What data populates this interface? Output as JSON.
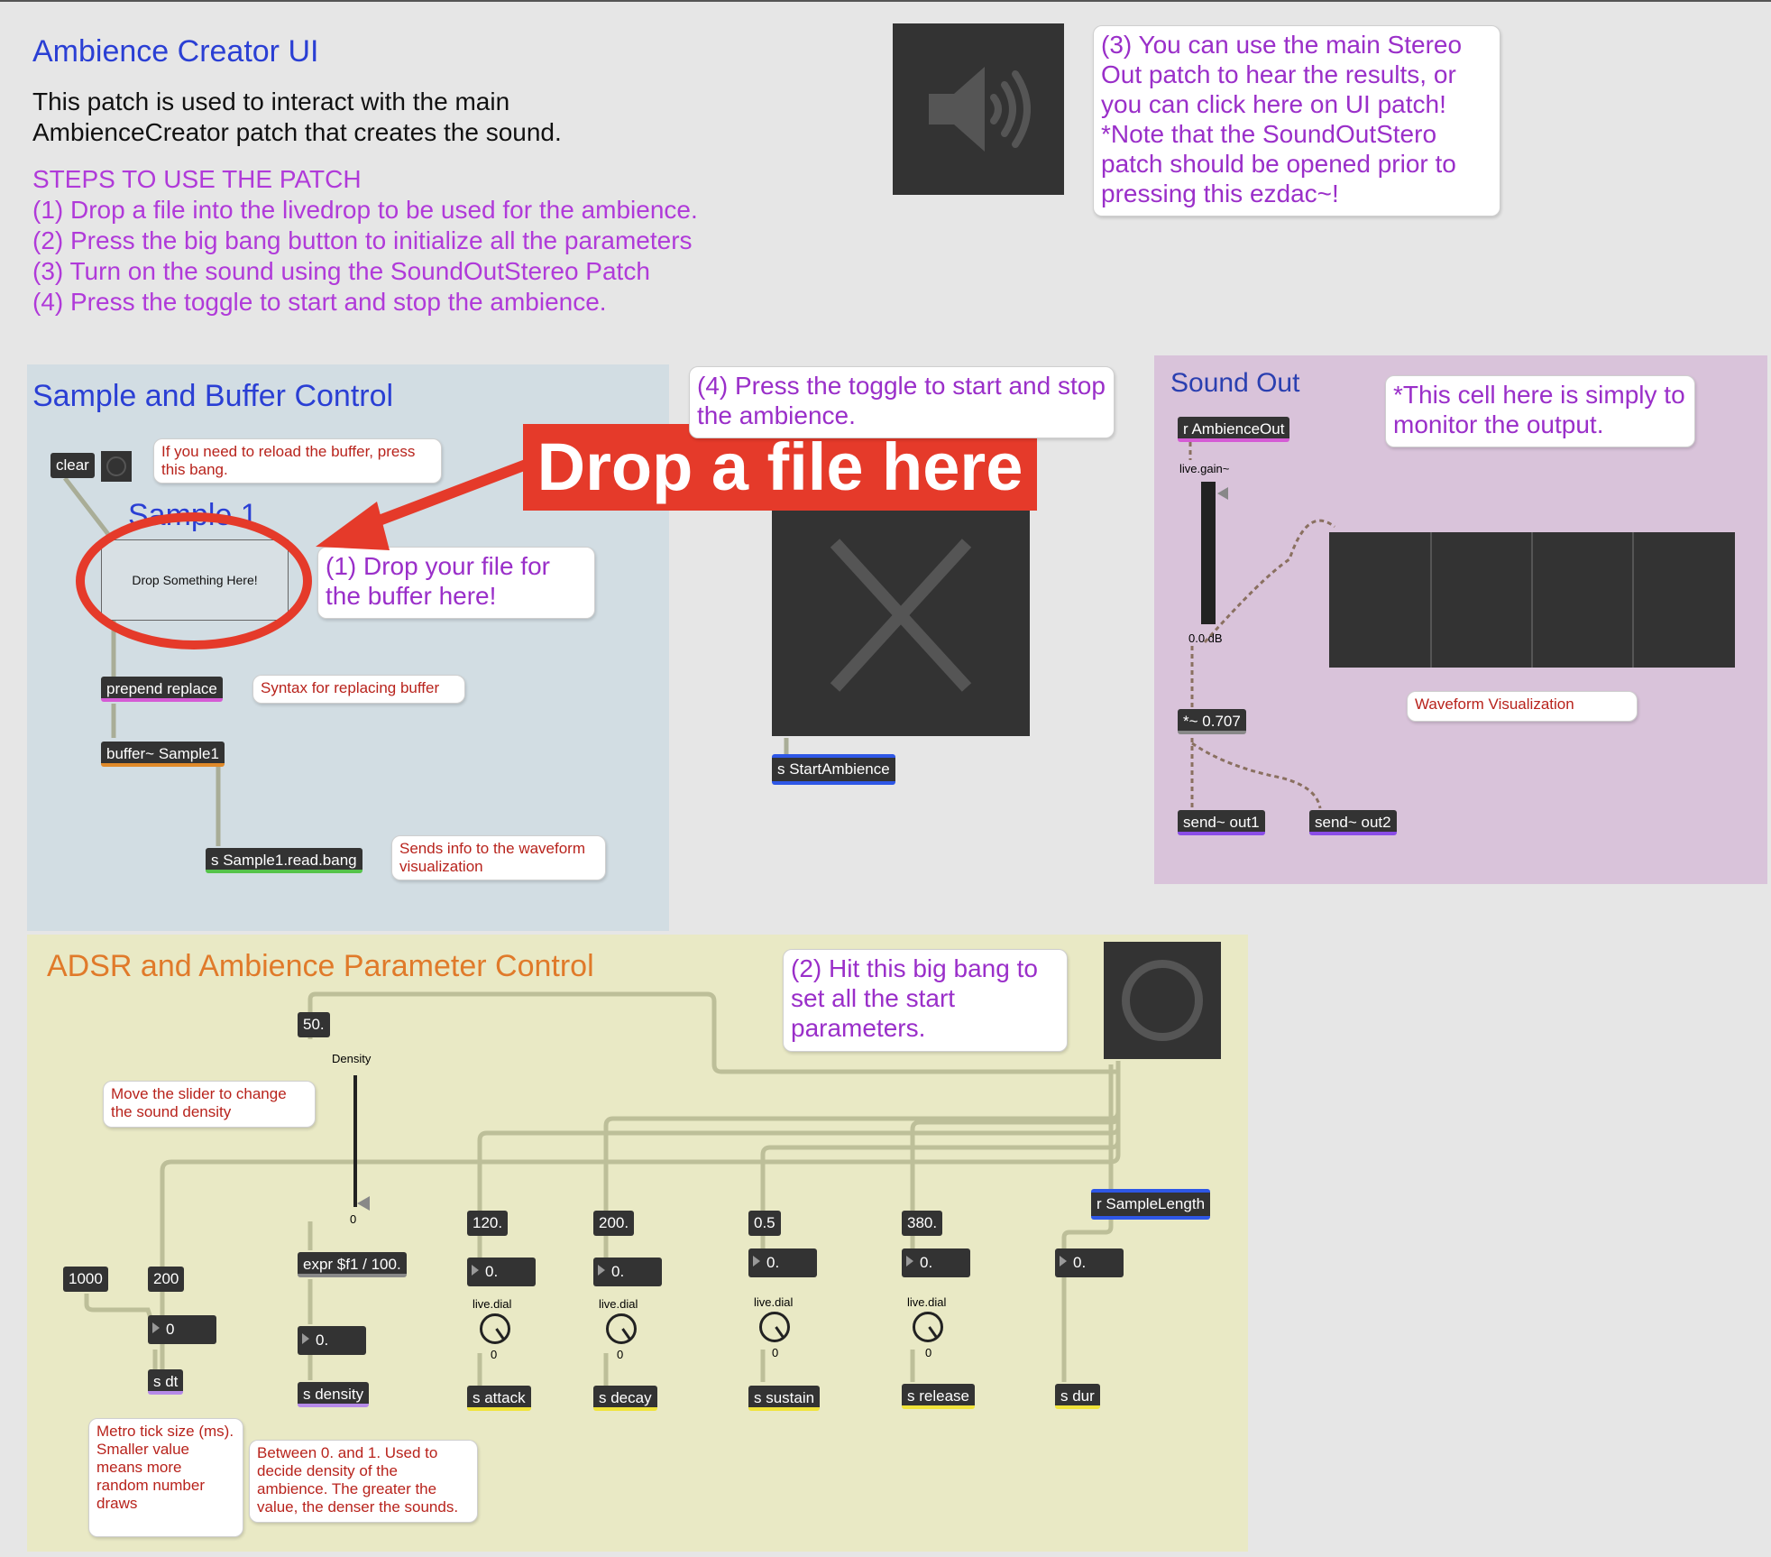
{
  "header": {
    "title": "Ambience Creator UI",
    "description_lines": [
      "This patch is used to interact with the main",
      "AmbienceCreator patch that creates the sound."
    ],
    "steps_title": "STEPS TO USE THE PATCH",
    "steps": [
      "(1) Drop a file into the livedrop to be used for the ambience.",
      "(2) Press the big bang button to initialize all the parameters",
      "(3) Turn on the sound using the SoundOutStereo Patch",
      "(4) Press the toggle to start and stop the ambience."
    ],
    "ezdac_comment": "(3) You can use the main Stereo Out patch to hear the results, or you can click here on UI patch! *Note that the SoundOutStero patch should be opened prior to pressing this ezdac~!",
    "ezdac_icon": "speaker-icon"
  },
  "sample_panel": {
    "title": "Sample and Buffer Control",
    "clear_label": "clear",
    "reload_comment": "If you need to reload the buffer, press this bang.",
    "sample_name": "Sample 1",
    "drop_text": "Drop Something Here!",
    "drop_comment": "(1) Drop your file for the buffer here!",
    "prepend_label": "prepend replace",
    "prepend_comment": "Syntax for replacing buffer",
    "buffer_label": "buffer~ Sample1",
    "send_label": "s Sample1.read.bang",
    "send_comment": "Sends info to the waveform visualization",
    "annotation_banner": "Drop a file here"
  },
  "toggle_panel": {
    "comment": "(4) Press the toggle to start and stop the ambience.",
    "send_label": "s StartAmbience",
    "toggle_icon": "close-x-icon"
  },
  "sound_out": {
    "title": "Sound Out",
    "comment": "*This cell here is simply to monitor the output.",
    "receive_label": "r AmbienceOut",
    "gain_label": "live.gain~",
    "gain_value": "0.0 dB",
    "mult_label": "*~ 0.707",
    "waveform_comment": "Waveform Visualization",
    "send1": "send~ out1",
    "send2": "send~ out2"
  },
  "adsr": {
    "title": "ADSR and Ambience Parameter Control",
    "bang_comment": "(2) Hit this big bang to set all the start parameters.",
    "density_msg": "50.",
    "density_label": "Density",
    "slider_comment": "Move the slider to change the sound density",
    "slider_value": "0",
    "msg_1000": "1000",
    "msg_200": "200",
    "dt_num": "0",
    "dt_send": "s dt",
    "dt_comment": "Metro tick size (ms). Smaller value means more random number draws",
    "expr_label": "expr $f1 / 100.",
    "density_num": "0.",
    "density_send": "s density",
    "density_comment": "Between 0. and 1. Used to decide density of the ambience. The greater the value, the denser the sounds.",
    "dial_label": "live.dial",
    "dial_value": "0",
    "params": [
      {
        "msg": "120.",
        "num": "0.",
        "send": "s attack"
      },
      {
        "msg": "200.",
        "num": "0.",
        "send": "s decay"
      },
      {
        "msg": "0.5",
        "num": "0.",
        "send": "s sustain"
      },
      {
        "msg": "380.",
        "num": "0.",
        "send": "s release"
      }
    ],
    "sample_length": "r SampleLength",
    "dur_num": "0.",
    "dur_send": "s dur"
  }
}
